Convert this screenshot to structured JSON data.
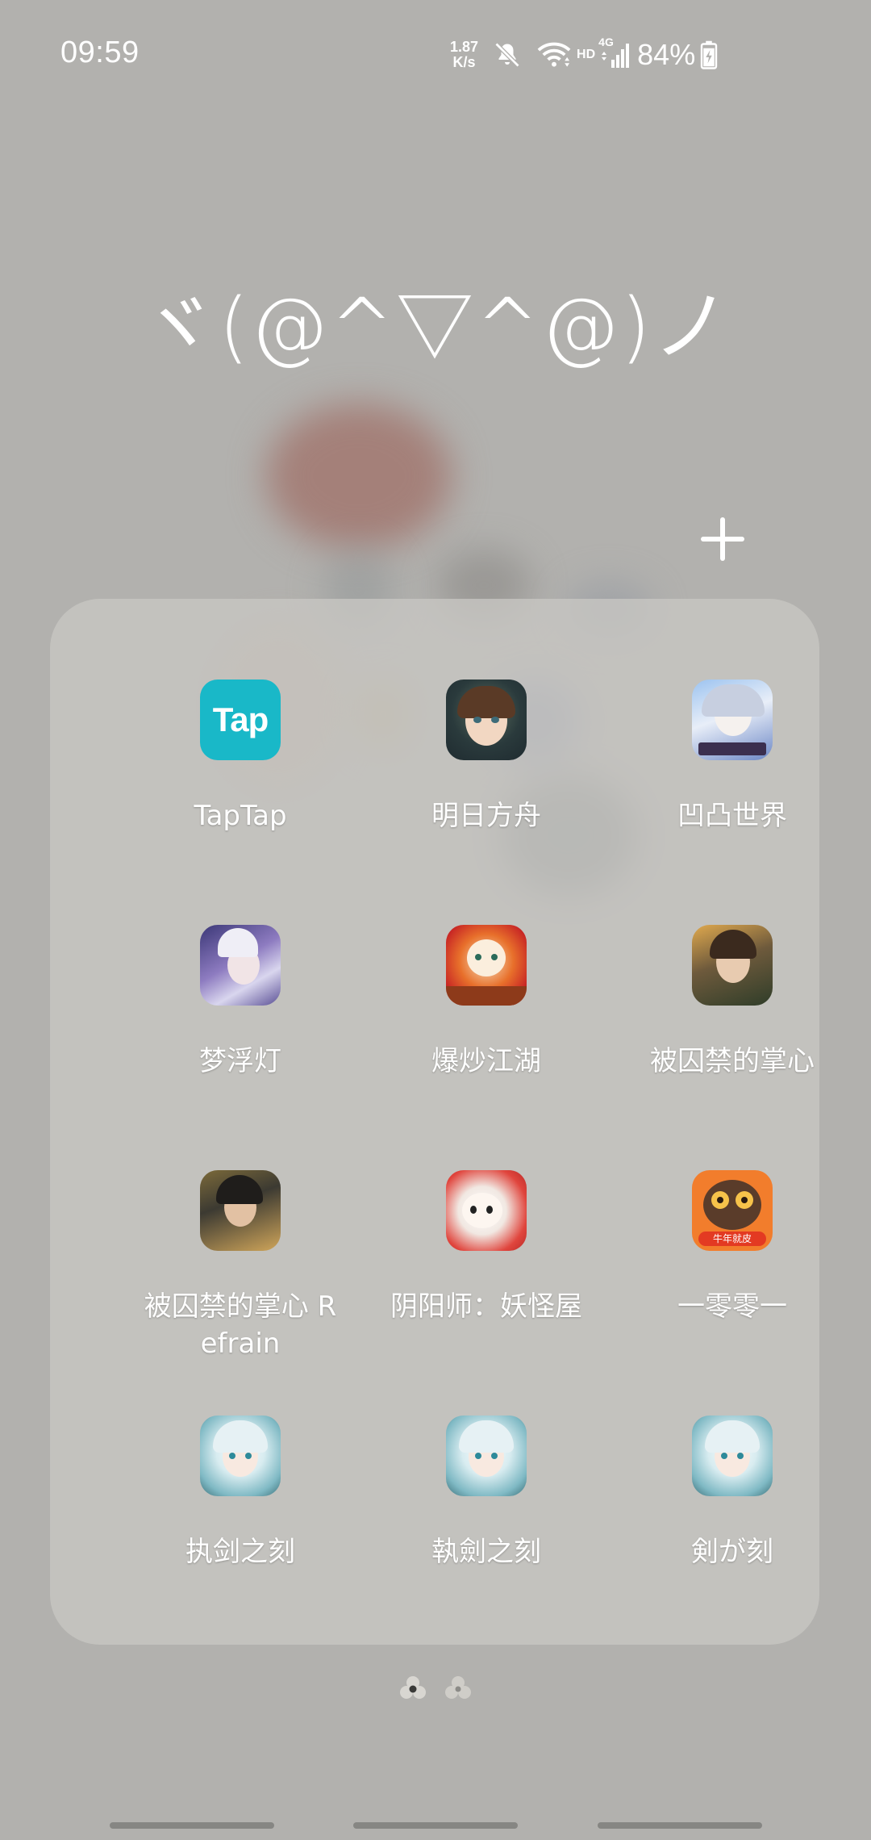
{
  "status_bar": {
    "time": "09:59",
    "net_speed_value": "1.87",
    "net_speed_unit": "K/s",
    "hd_label": "HD",
    "network_type": "4G",
    "battery_percent": "84%"
  },
  "folder": {
    "title": "ヾ(@^▽^@)ノ",
    "add_icon": "plus-icon",
    "apps": [
      {
        "label": "TapTap",
        "icon": "taptap-icon",
        "icon_text": "Tap"
      },
      {
        "label": "明日方舟",
        "icon": "arknights-icon"
      },
      {
        "label": "凹凸世界",
        "icon": "aotu-world-icon"
      },
      {
        "label": "梦浮灯",
        "icon": "meng-fu-deng-icon"
      },
      {
        "label": "爆炒江湖",
        "icon": "bao-chao-jiang-hu-icon"
      },
      {
        "label": "被囚禁的掌心",
        "icon": "bei-qiu-jin-icon"
      },
      {
        "label": "被囚禁的掌心 Refrain",
        "icon": "bei-qiu-jin-refrain-icon"
      },
      {
        "label": "阴阳师：妖怪屋",
        "icon": "onmyoji-yokai-house-icon"
      },
      {
        "label": "一零零一",
        "icon": "yi-ling-ling-yi-icon",
        "icon_text": "牛年就皮"
      },
      {
        "label": "执剑之刻",
        "icon": "zhi-jian-zhi-ke-icon"
      },
      {
        "label": "執劍之刻",
        "icon": "zhi-jian-zhi-ke-tw-icon"
      },
      {
        "label": "剣が刻",
        "icon": "ken-ga-toki-icon"
      }
    ]
  },
  "pager": {
    "pages": 2,
    "current": 1
  },
  "colors": {
    "wallpaper": "#b2b1ae",
    "panel": "#c8c7c3",
    "text": "#ffffff",
    "taptap": "#19b8c8",
    "yi_ling_ling_yi": "#f27d2c"
  }
}
